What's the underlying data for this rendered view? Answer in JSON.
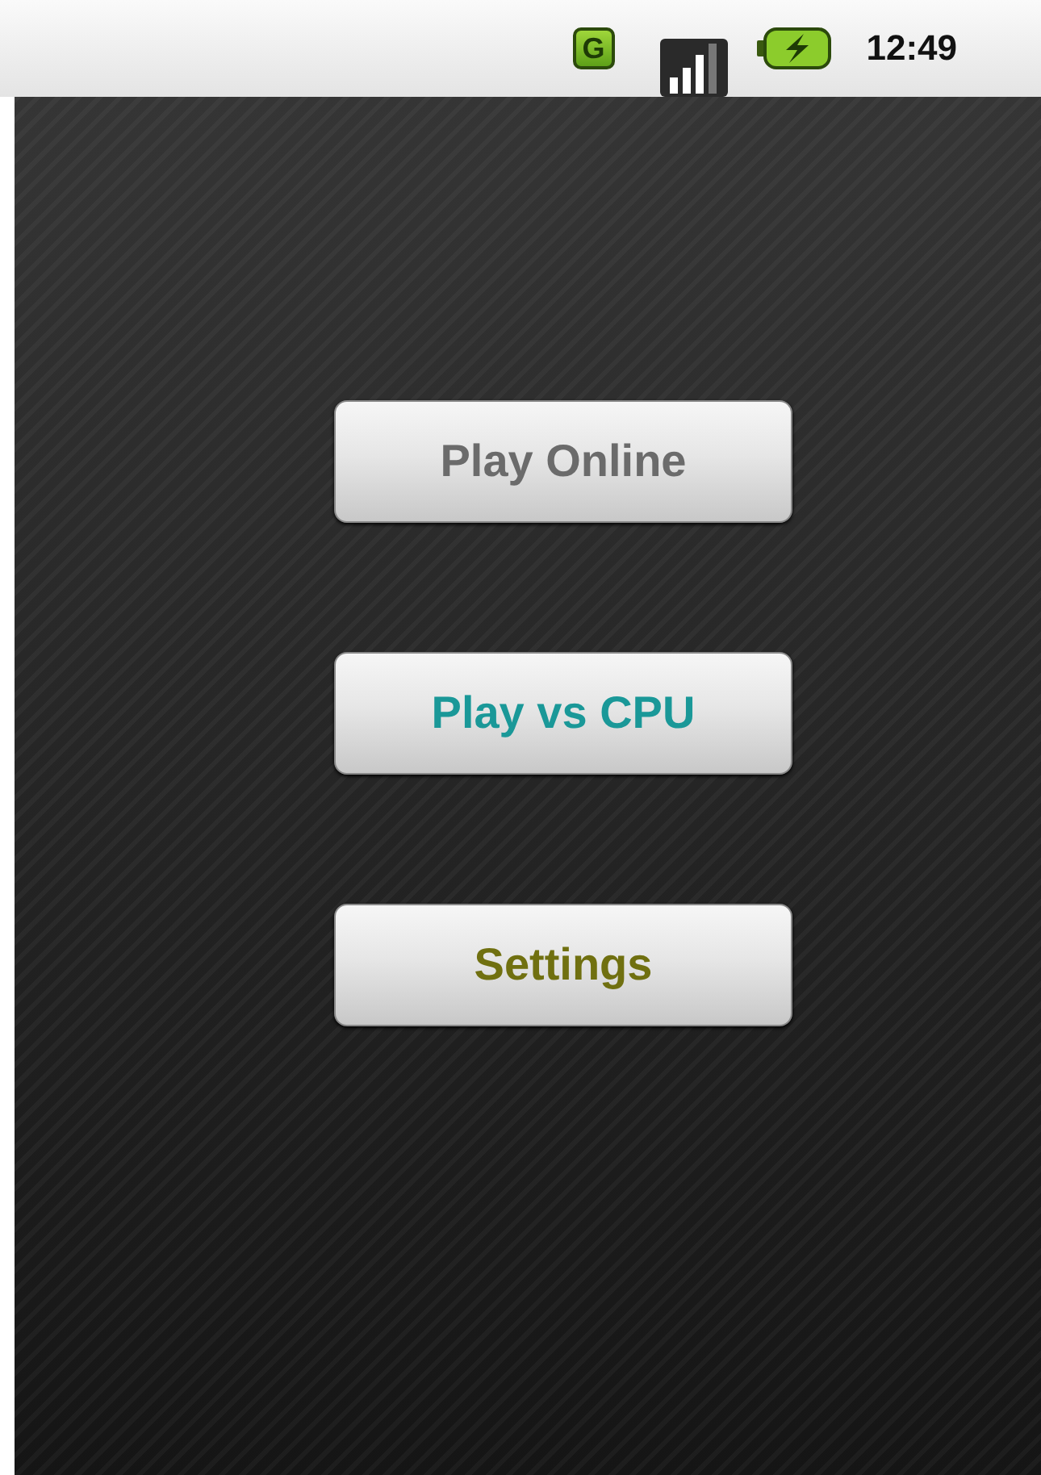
{
  "status_bar": {
    "network_type": "G",
    "time": "12:49"
  },
  "buttons": [
    {
      "label": "Play Online",
      "color": "#6b6b6b"
    },
    {
      "label": "Play vs CPU",
      "color": "#1a9898"
    },
    {
      "label": "Settings",
      "color": "#707010"
    }
  ]
}
